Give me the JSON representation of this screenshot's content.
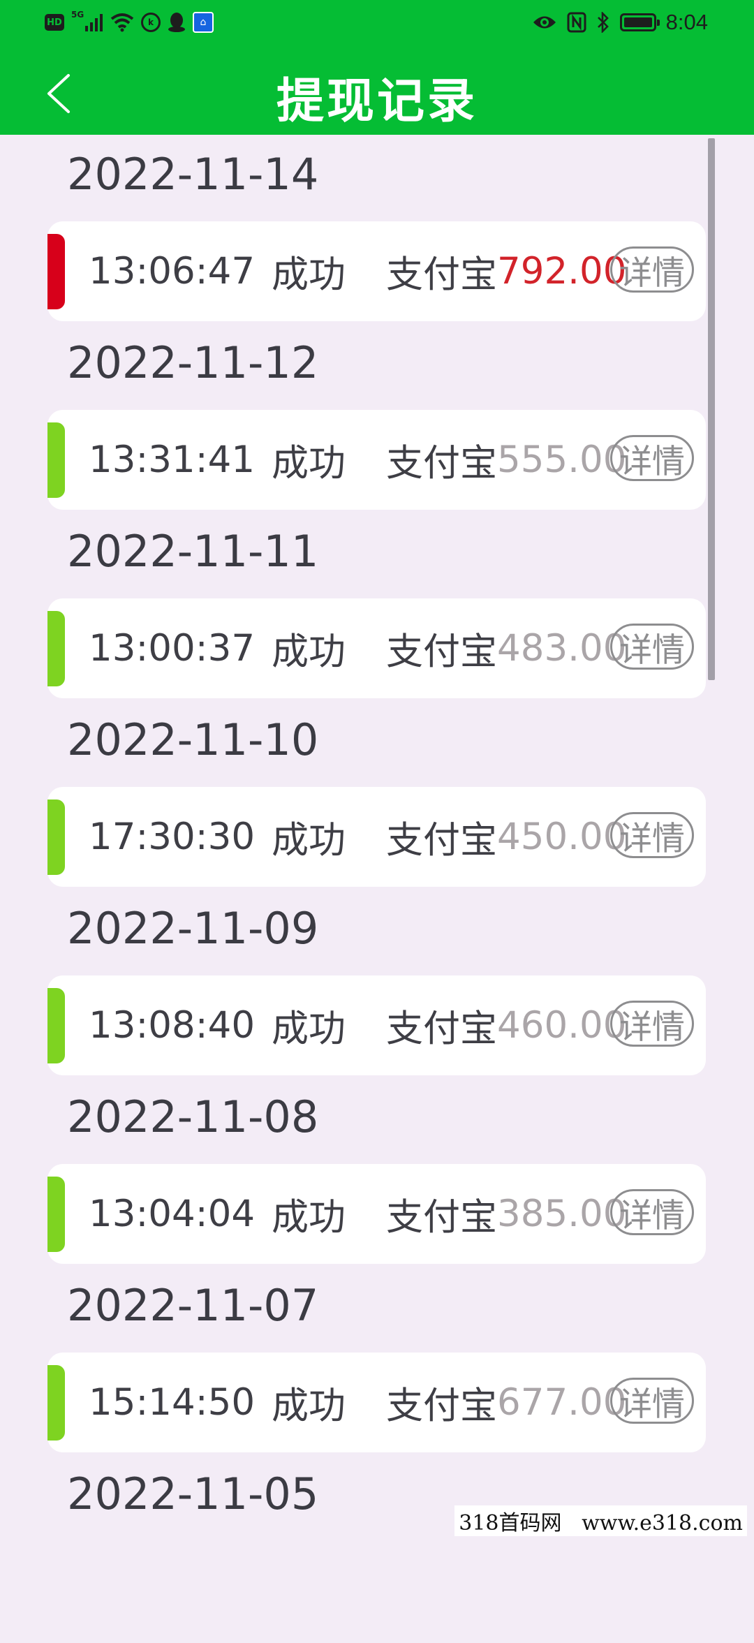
{
  "status_bar": {
    "time": "8:04",
    "network": "5G",
    "hd_label": "HD",
    "left_icons": [
      "hd-icon",
      "signal-icon",
      "wifi-icon",
      "app-circle-icon",
      "qq-penguin-icon",
      "app-square-icon"
    ],
    "right_icons": [
      "eye-icon",
      "nfc-icon",
      "bluetooth-icon",
      "battery-icon"
    ]
  },
  "header": {
    "title": "提现记录",
    "background": "#05bd34"
  },
  "records": [
    {
      "date": "2022-11-14",
      "time": "13:06:47",
      "status": "成功",
      "method": "支付宝",
      "amount": "792.00",
      "detail": "详情",
      "accent": "#d7001a",
      "amount_color": "#d2232a"
    },
    {
      "date": "2022-11-12",
      "time": "13:31:41",
      "status": "成功",
      "method": "支付宝",
      "amount": "555.00",
      "detail": "详情",
      "accent": "#7ed321",
      "amount_color": "#aaa5a8"
    },
    {
      "date": "2022-11-11",
      "time": "13:00:37",
      "status": "成功",
      "method": "支付宝",
      "amount": "483.00",
      "detail": "详情",
      "accent": "#7ed321",
      "amount_color": "#aaa5a8"
    },
    {
      "date": "2022-11-10",
      "time": "17:30:30",
      "status": "成功",
      "method": "支付宝",
      "amount": "450.00",
      "detail": "详情",
      "accent": "#7ed321",
      "amount_color": "#aaa5a8"
    },
    {
      "date": "2022-11-09",
      "time": "13:08:40",
      "status": "成功",
      "method": "支付宝",
      "amount": "460.00",
      "detail": "详情",
      "accent": "#7ed321",
      "amount_color": "#aaa5a8"
    },
    {
      "date": "2022-11-08",
      "time": "13:04:04",
      "status": "成功",
      "method": "支付宝",
      "amount": "385.00",
      "detail": "详情",
      "accent": "#7ed321",
      "amount_color": "#aaa5a8"
    },
    {
      "date": "2022-11-07",
      "time": "15:14:50",
      "status": "成功",
      "method": "支付宝",
      "amount": "677.00",
      "detail": "详情",
      "accent": "#7ed321",
      "amount_color": "#aaa5a8"
    },
    {
      "date": "2022-11-05"
    }
  ],
  "watermark": "318首码网   www.e318.com"
}
